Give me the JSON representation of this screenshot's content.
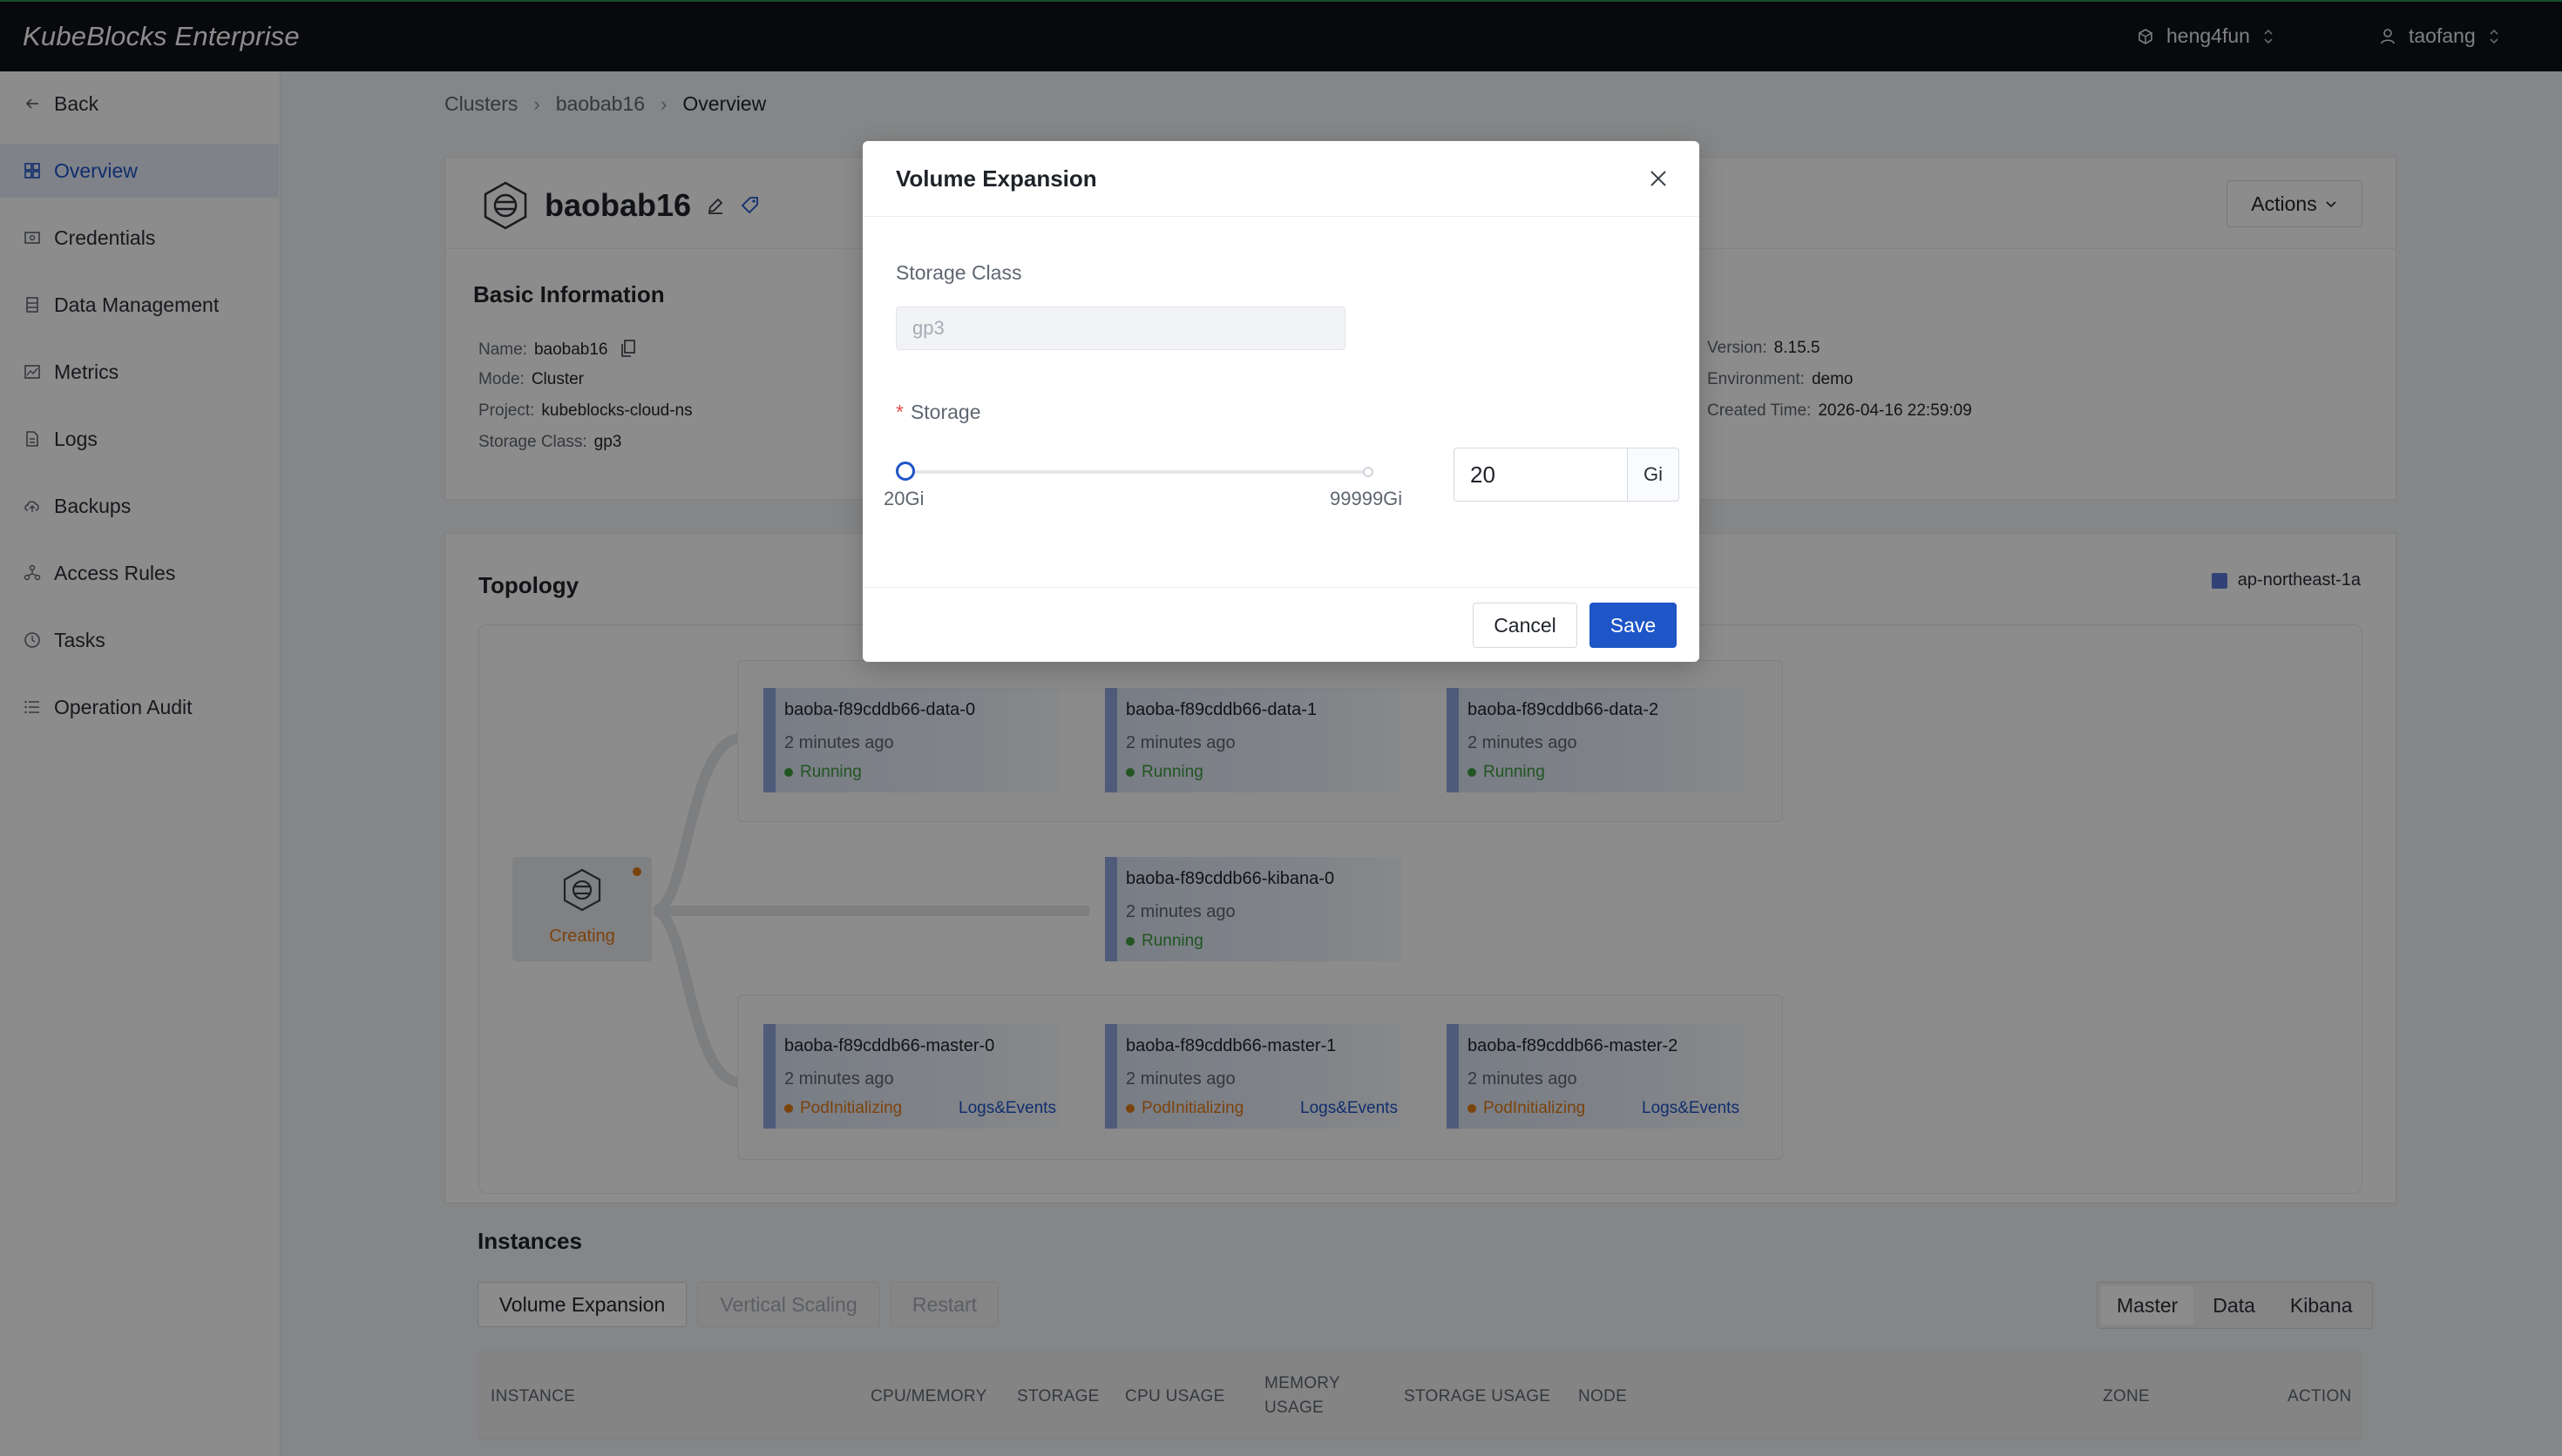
{
  "topbar": {
    "brand": "KubeBlocks Enterprise",
    "org": "heng4fun",
    "user": "taofang"
  },
  "sidebar": {
    "items": [
      {
        "label": "Back",
        "icon": "arrow-left-icon"
      },
      {
        "label": "Overview",
        "icon": "grid-icon",
        "active": true
      },
      {
        "label": "Credentials",
        "icon": "credential-icon"
      },
      {
        "label": "Data Management",
        "icon": "database-icon"
      },
      {
        "label": "Metrics",
        "icon": "chart-icon"
      },
      {
        "label": "Logs",
        "icon": "document-icon"
      },
      {
        "label": "Backups",
        "icon": "cloud-upload-icon"
      },
      {
        "label": "Access Rules",
        "icon": "network-icon"
      },
      {
        "label": "Tasks",
        "icon": "clock-icon"
      },
      {
        "label": "Operation Audit",
        "icon": "list-icon"
      }
    ],
    "collapse": "«"
  },
  "breadcrumb": [
    "Clusters",
    "baobab16",
    "Overview"
  ],
  "cluster": {
    "name": "baobab16",
    "actions_label": "Actions",
    "basic_info_title": "Basic Information",
    "info_left": [
      {
        "label": "Name:",
        "value": "baobab16"
      },
      {
        "label": "Mode:",
        "value": "Cluster"
      },
      {
        "label": "Project:",
        "value": "kubeblocks-cloud-ns"
      },
      {
        "label": "Storage Class:",
        "value": "gp3"
      }
    ],
    "info_right": [
      {
        "label": "Version:",
        "value": "8.15.5"
      },
      {
        "label": "Environment:",
        "value": "demo"
      },
      {
        "label": "Created Time:",
        "value": "2026-04-16 22:59:09"
      }
    ]
  },
  "topology": {
    "title": "Topology",
    "legend": "ap-northeast-1a",
    "root_status": "Creating",
    "data_pods": [
      {
        "name": "baoba-f89cddb66-data-0",
        "time": "2 minutes ago",
        "status": "Running"
      },
      {
        "name": "baoba-f89cddb66-data-1",
        "time": "2 minutes ago",
        "status": "Running"
      },
      {
        "name": "baoba-f89cddb66-data-2",
        "time": "2 minutes ago",
        "status": "Running"
      }
    ],
    "kibana_pod": {
      "name": "baoba-f89cddb66-kibana-0",
      "time": "2 minutes ago",
      "status": "Running"
    },
    "master_pods": [
      {
        "name": "baoba-f89cddb66-master-0",
        "time": "2 minutes ago",
        "status": "PodInitializing",
        "link": "Logs&Events"
      },
      {
        "name": "baoba-f89cddb66-master-1",
        "time": "2 minutes ago",
        "status": "PodInitializing",
        "link": "Logs&Events"
      },
      {
        "name": "baoba-f89cddb66-master-2",
        "time": "2 minutes ago",
        "status": "PodInitializing",
        "link": "Logs&Events"
      }
    ]
  },
  "instances": {
    "title": "Instances",
    "buttons": [
      "Volume Expansion",
      "Vertical Scaling",
      "Restart"
    ],
    "tabs": [
      "Master",
      "Data",
      "Kibana"
    ],
    "columns": [
      "INSTANCE",
      "CPU/MEMORY",
      "STORAGE",
      "CPU USAGE",
      "MEMORY USAGE",
      "STORAGE USAGE",
      "NODE",
      "ZONE",
      "ACTION"
    ]
  },
  "modal": {
    "title": "Volume Expansion",
    "storage_class_label": "Storage Class",
    "storage_class_value": "gp3",
    "storage_label": "Storage",
    "required_mark": "*",
    "slider_min": "20Gi",
    "slider_max": "99999Gi",
    "storage_value": "20",
    "unit": "Gi",
    "cancel": "Cancel",
    "save": "Save"
  },
  "colors": {
    "accent": "#1e55c7",
    "running": "#3d9b3d",
    "initializing": "#e07b16",
    "topbar": "#0f1116"
  }
}
